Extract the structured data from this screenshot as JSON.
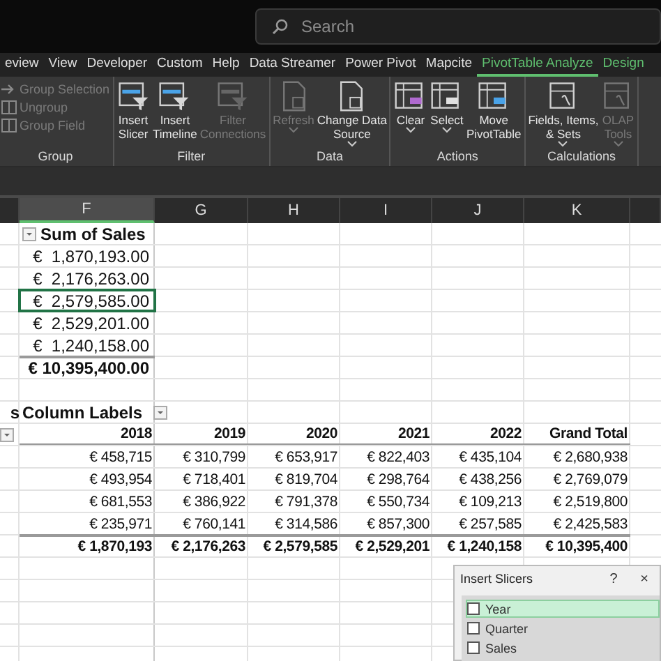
{
  "search": {
    "placeholder": "Search"
  },
  "tabs": [
    {
      "label": "eview",
      "selected": false,
      "contextual": false
    },
    {
      "label": "View",
      "selected": false,
      "contextual": false
    },
    {
      "label": "Developer",
      "selected": false,
      "contextual": false
    },
    {
      "label": "Custom",
      "selected": false,
      "contextual": false
    },
    {
      "label": "Help",
      "selected": false,
      "contextual": false
    },
    {
      "label": "Data Streamer",
      "selected": false,
      "contextual": false
    },
    {
      "label": "Power Pivot",
      "selected": false,
      "contextual": false
    },
    {
      "label": "Mapcite",
      "selected": false,
      "contextual": false
    },
    {
      "label": "PivotTable Analyze",
      "selected": true,
      "contextual": true
    },
    {
      "label": "Design",
      "selected": false,
      "contextual": true
    }
  ],
  "ribbon_groups": [
    {
      "name": "Group",
      "kind": "list",
      "buttons": [
        {
          "lines": [
            "Group Selection"
          ],
          "disabled": true
        },
        {
          "lines": [
            "Ungroup"
          ],
          "disabled": true
        },
        {
          "lines": [
            "Group Field"
          ],
          "disabled": true
        }
      ]
    },
    {
      "name": "Filter",
      "kind": "large",
      "buttons": [
        {
          "lines": [
            "Insert",
            "Slicer"
          ],
          "disabled": false,
          "dropdown": false
        },
        {
          "lines": [
            "Insert",
            "Timeline"
          ],
          "disabled": false,
          "dropdown": false
        },
        {
          "lines": [
            "Filter",
            "Connections"
          ],
          "disabled": true,
          "dropdown": false
        }
      ]
    },
    {
      "name": "Data",
      "kind": "large",
      "buttons": [
        {
          "lines": [
            "Refresh"
          ],
          "disabled": true,
          "dropdown": true
        },
        {
          "lines": [
            "Change Data",
            "Source"
          ],
          "disabled": false,
          "dropdown": true
        }
      ]
    },
    {
      "name": "Actions",
      "kind": "large",
      "buttons": [
        {
          "lines": [
            "Clear"
          ],
          "disabled": false,
          "dropdown": true
        },
        {
          "lines": [
            "Select"
          ],
          "disabled": false,
          "dropdown": true
        },
        {
          "lines": [
            "Move",
            "PivotTable"
          ],
          "disabled": false,
          "dropdown": false
        }
      ]
    },
    {
      "name": "Calculations",
      "kind": "large",
      "buttons": [
        {
          "lines": [
            "Fields, Items,",
            "& Sets"
          ],
          "disabled": false,
          "dropdown": true
        },
        {
          "lines": [
            "OLAP",
            "Tools"
          ],
          "disabled": true,
          "dropdown": true
        }
      ]
    }
  ],
  "columns": [
    {
      "label": "F",
      "selected": true
    },
    {
      "label": "G",
      "selected": false
    },
    {
      "label": "H",
      "selected": false
    },
    {
      "label": "I",
      "selected": false
    },
    {
      "label": "J",
      "selected": false
    },
    {
      "label": "K",
      "selected": false
    }
  ],
  "summary": {
    "header": "Sum of Sales",
    "values": [
      {
        "text": "€  1,870,193.00",
        "selected": false
      },
      {
        "text": "€  2,176,263.00",
        "selected": false
      },
      {
        "text": "€  2,579,585.00",
        "selected": true
      },
      {
        "text": "€  2,529,201.00",
        "selected": false
      },
      {
        "text": "€  1,240,158.00",
        "selected": false
      }
    ],
    "total": "€ 10,395,400.00"
  },
  "matrix": {
    "corner": "s",
    "header": "Column Labels",
    "years": [
      "2018",
      "2019",
      "2020",
      "2021",
      "2022",
      "Grand Total"
    ],
    "rows": [
      [
        "€ 458,715",
        "€ 310,799",
        "€ 653,917",
        "€ 822,403",
        "€ 435,104",
        "€ 2,680,938"
      ],
      [
        "€ 493,954",
        "€ 718,401",
        "€ 819,704",
        "€ 298,764",
        "€ 438,256",
        "€ 2,769,079"
      ],
      [
        "€ 681,553",
        "€ 386,922",
        "€ 791,378",
        "€ 550,734",
        "€ 109,213",
        "€ 2,519,800"
      ],
      [
        "€ 235,971",
        "€ 760,141",
        "€ 314,586",
        "€ 857,300",
        "€ 257,585",
        "€ 2,425,583"
      ]
    ],
    "total": [
      "€ 1,870,193",
      "€ 2,176,263",
      "€ 2,579,585",
      "€ 2,529,201",
      "€ 1,240,158",
      "€ 10,395,400"
    ]
  },
  "dialog": {
    "title": "Insert Slicers",
    "help": "?",
    "close": "×",
    "fields": [
      {
        "label": "Year",
        "selected": true,
        "checked": false
      },
      {
        "label": "Quarter",
        "selected": false,
        "checked": false
      },
      {
        "label": "Sales",
        "selected": false,
        "checked": false
      }
    ]
  }
}
